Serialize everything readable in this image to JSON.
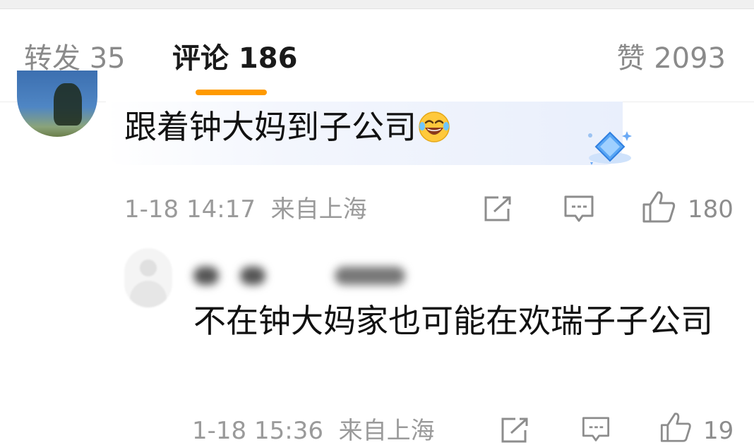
{
  "tabs": [
    {
      "label": "转发 35",
      "state": "inactive"
    },
    {
      "label": "评论 186",
      "state": "active"
    },
    {
      "label": "赞 2093",
      "state": "inactive"
    }
  ],
  "accent_color": "#ff9a00",
  "comments": [
    {
      "text": "跟着钟大妈到子公司",
      "emoji": "face-with-tears-of-joy",
      "time": "1-18 14:17",
      "location": "来自上海",
      "likes": "180",
      "has_badge": true
    },
    {
      "author_blurred": true,
      "text": "不在钟大妈家也可能在欢瑞子子公司",
      "time": "1-18 15:36",
      "location": "来自上海",
      "likes": "19"
    }
  ],
  "icons": [
    "share-icon",
    "comment-icon",
    "like-icon",
    "diamond-badge-icon"
  ]
}
